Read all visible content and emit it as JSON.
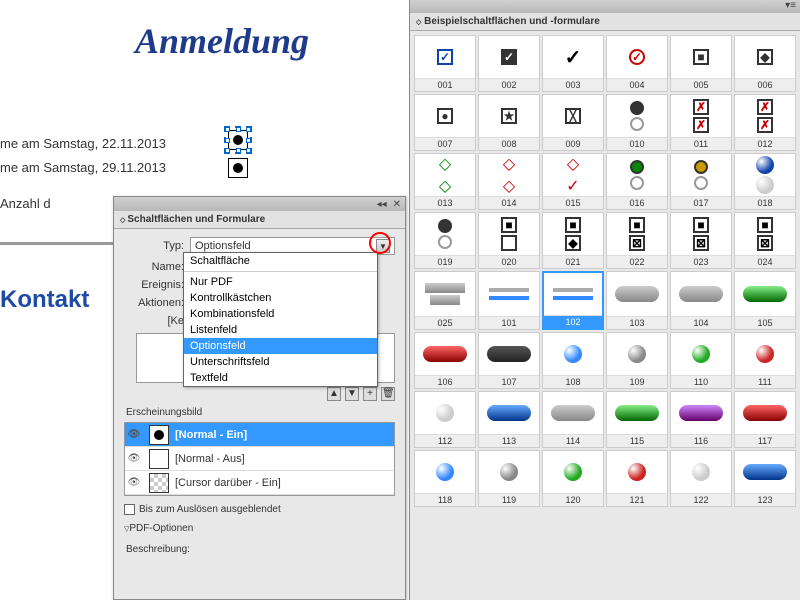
{
  "doc": {
    "title": "Anmeldung",
    "line1": "me am Samstag, 22.11.2013",
    "line2": "me am Samstag, 29.11.2013",
    "line3": "Anzahl d",
    "kontakt": "Kontakt"
  },
  "forms_panel": {
    "title": "Schaltflächen und Formulare",
    "rows": {
      "typ_label": "Typ:",
      "typ_value": "Optionsfeld",
      "name_label": "Name:",
      "ereignis_label": "Ereignis:",
      "aktionen_label": "Aktionen:",
      "ke_label": "[Ke"
    },
    "dropdown": {
      "items": [
        "Schaltfläche",
        "Nur PDF",
        "Kontrollkästchen",
        "Kombinationsfeld",
        "Listenfeld",
        "Optionsfeld",
        "Unterschriftsfeld",
        "Textfeld"
      ],
      "highlighted": "Optionsfeld"
    },
    "appearance_label": "Erscheinungsbild",
    "appearance": [
      {
        "label": "[Normal - Ein]",
        "hl": true,
        "dot": true
      },
      {
        "label": "[Normal - Aus]",
        "hl": false,
        "dot": false
      },
      {
        "label": "[Cursor darüber - Ein]",
        "hl": false,
        "checker": true
      }
    ],
    "hide_label": "Bis zum Auslösen ausgeblendet",
    "pdf_label": "PDF-Optionen",
    "desc_label": "Beschreibung:"
  },
  "library": {
    "title": "Beispielschaltflächen und -formulare",
    "items": [
      {
        "id": "001",
        "t": "ck",
        "c": "#14a",
        "s": "✓"
      },
      {
        "id": "002",
        "t": "ck",
        "c": "#333",
        "bg": "#333",
        "fg": "#fff",
        "s": "✓"
      },
      {
        "id": "003",
        "t": "plain",
        "s": "✓"
      },
      {
        "id": "004",
        "t": "ck",
        "c": "#c00",
        "s": "✓",
        "shape": "circ"
      },
      {
        "id": "005",
        "t": "ck",
        "c": "#333",
        "s": "■"
      },
      {
        "id": "006",
        "t": "ck",
        "c": "#333",
        "s": "◆"
      },
      {
        "id": "007",
        "t": "ck",
        "c": "#333",
        "s": "●"
      },
      {
        "id": "008",
        "t": "ck",
        "c": "#333",
        "s": "★"
      },
      {
        "id": "009",
        "t": "ck",
        "c": "#333",
        "s": "╳"
      },
      {
        "id": "010",
        "t": "rad2"
      },
      {
        "id": "011",
        "t": "xr",
        "c": "#c00"
      },
      {
        "id": "012",
        "t": "xr",
        "c": "#c00"
      },
      {
        "id": "013",
        "t": "diam",
        "c": "#080"
      },
      {
        "id": "014",
        "t": "diam",
        "c": "#c00"
      },
      {
        "id": "015",
        "t": "diam",
        "c": "#c00",
        "s": "✓"
      },
      {
        "id": "016",
        "t": "rad2",
        "c": "#080"
      },
      {
        "id": "017",
        "t": "rad2",
        "c": "#c90"
      },
      {
        "id": "018",
        "t": "orb2",
        "c": "#14a"
      },
      {
        "id": "019",
        "t": "rad2",
        "c": "#333"
      },
      {
        "id": "020",
        "t": "sq2"
      },
      {
        "id": "021",
        "t": "sq2",
        "s": "◆"
      },
      {
        "id": "022",
        "t": "sq2",
        "s": "⊠"
      },
      {
        "id": "023",
        "t": "sq2",
        "s": "⊠"
      },
      {
        "id": "024",
        "t": "sq2",
        "s": "⊠"
      },
      {
        "id": "025",
        "t": "bars"
      },
      {
        "id": "101",
        "t": "bar2"
      },
      {
        "id": "102",
        "t": "bar2",
        "sel": true
      },
      {
        "id": "103",
        "t": "pill",
        "c": "gr"
      },
      {
        "id": "104",
        "t": "pill",
        "c": "gr"
      },
      {
        "id": "105",
        "t": "pill",
        "c": "g"
      },
      {
        "id": "106",
        "t": "pill",
        "c": "r"
      },
      {
        "id": "107",
        "t": "pill",
        "c": ""
      },
      {
        "id": "108",
        "t": "orb",
        "c": "#38f"
      },
      {
        "id": "109",
        "t": "orb",
        "c": "#888"
      },
      {
        "id": "110",
        "t": "orb",
        "c": "#2a2"
      },
      {
        "id": "111",
        "t": "orb",
        "c": "#c22"
      },
      {
        "id": "112",
        "t": "orb",
        "c": "#ccc"
      },
      {
        "id": "113",
        "t": "pill",
        "c": "b"
      },
      {
        "id": "114",
        "t": "pill",
        "c": "gr"
      },
      {
        "id": "115",
        "t": "pill",
        "c": "g"
      },
      {
        "id": "116",
        "t": "pill",
        "c": "pu"
      },
      {
        "id": "117",
        "t": "pill",
        "c": "r"
      },
      {
        "id": "118",
        "t": "orb",
        "c": "#38f"
      },
      {
        "id": "119",
        "t": "orb",
        "c": "#888"
      },
      {
        "id": "120",
        "t": "orb",
        "c": "#2a2"
      },
      {
        "id": "121",
        "t": "orb",
        "c": "#c22"
      },
      {
        "id": "122",
        "t": "orb",
        "c": "#ccc"
      },
      {
        "id": "123",
        "t": "pill",
        "c": "b"
      }
    ]
  }
}
